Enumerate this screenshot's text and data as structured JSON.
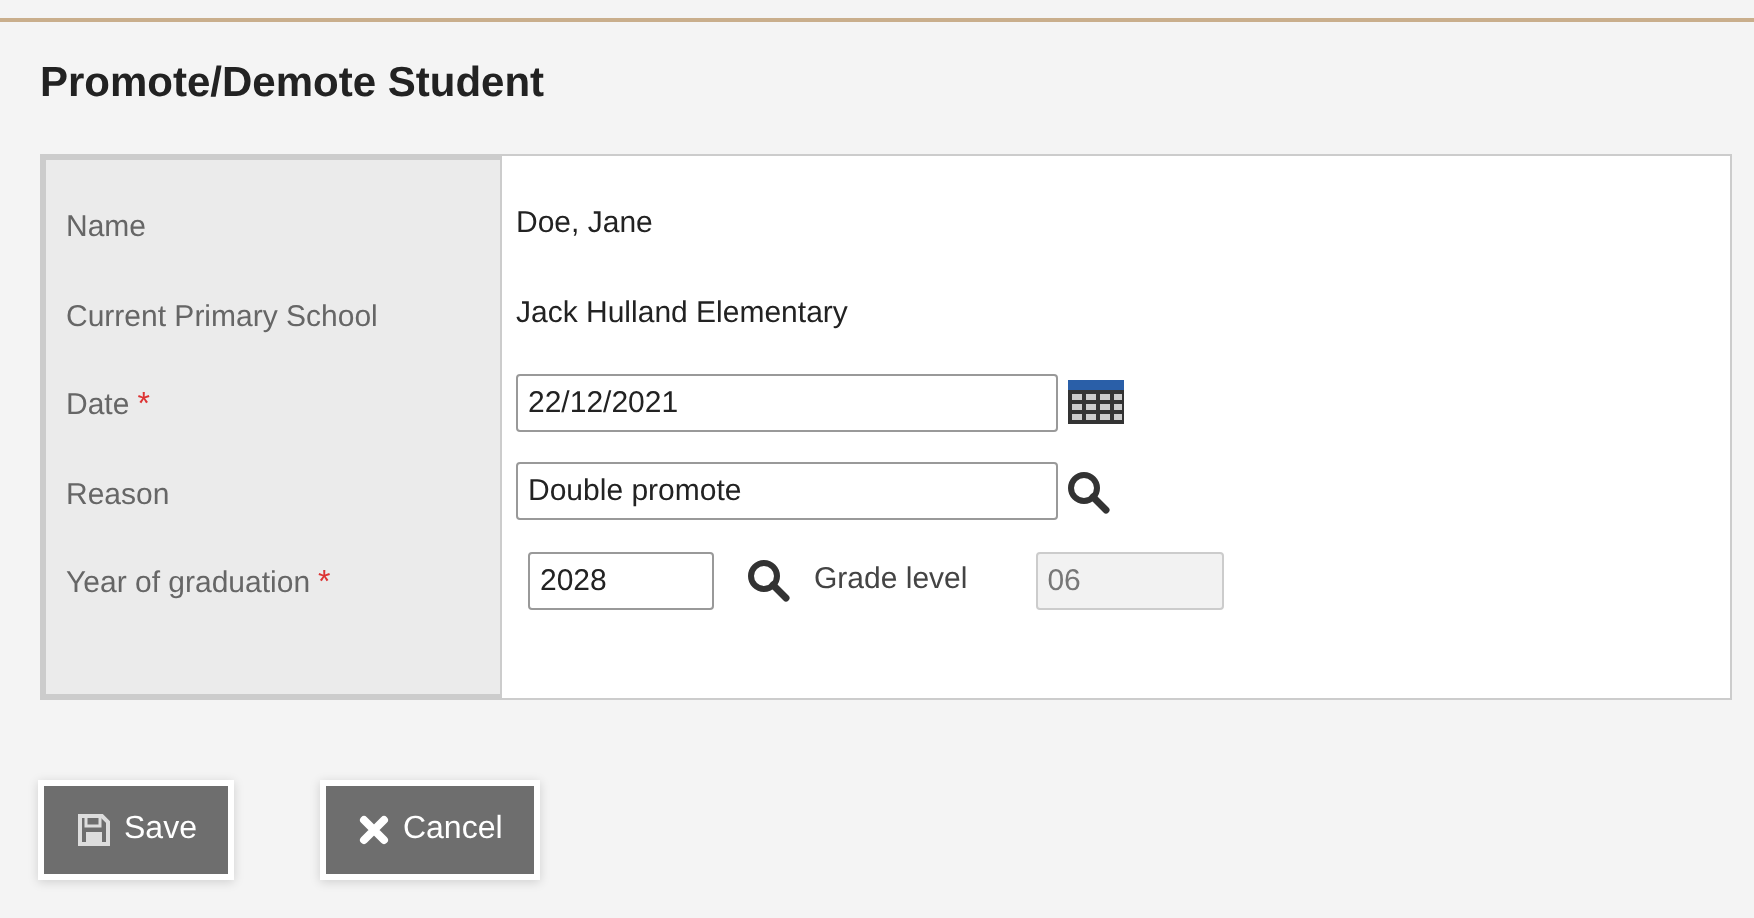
{
  "title": "Promote/Demote Student",
  "fields": [
    {
      "kind": "text",
      "label": "Name",
      "value": "Doe, Jane"
    },
    {
      "kind": "text",
      "label": "Current Primary School",
      "value": "Jack Hulland Elementary"
    },
    {
      "kind": "date",
      "label": "Date",
      "required_mark": "*",
      "value": "22/12/2021"
    },
    {
      "kind": "lookup",
      "label": "Reason",
      "value": "Double promote"
    },
    {
      "kind": "graduation",
      "label": "Year of graduation",
      "required_mark": "*",
      "value": "2028",
      "extra_label": "Grade level",
      "extra_value": "06",
      "extra_disabled": true
    }
  ],
  "buttons": [
    {
      "kind": "save",
      "label": "Save"
    },
    {
      "kind": "cancel",
      "label": "Cancel"
    }
  ]
}
